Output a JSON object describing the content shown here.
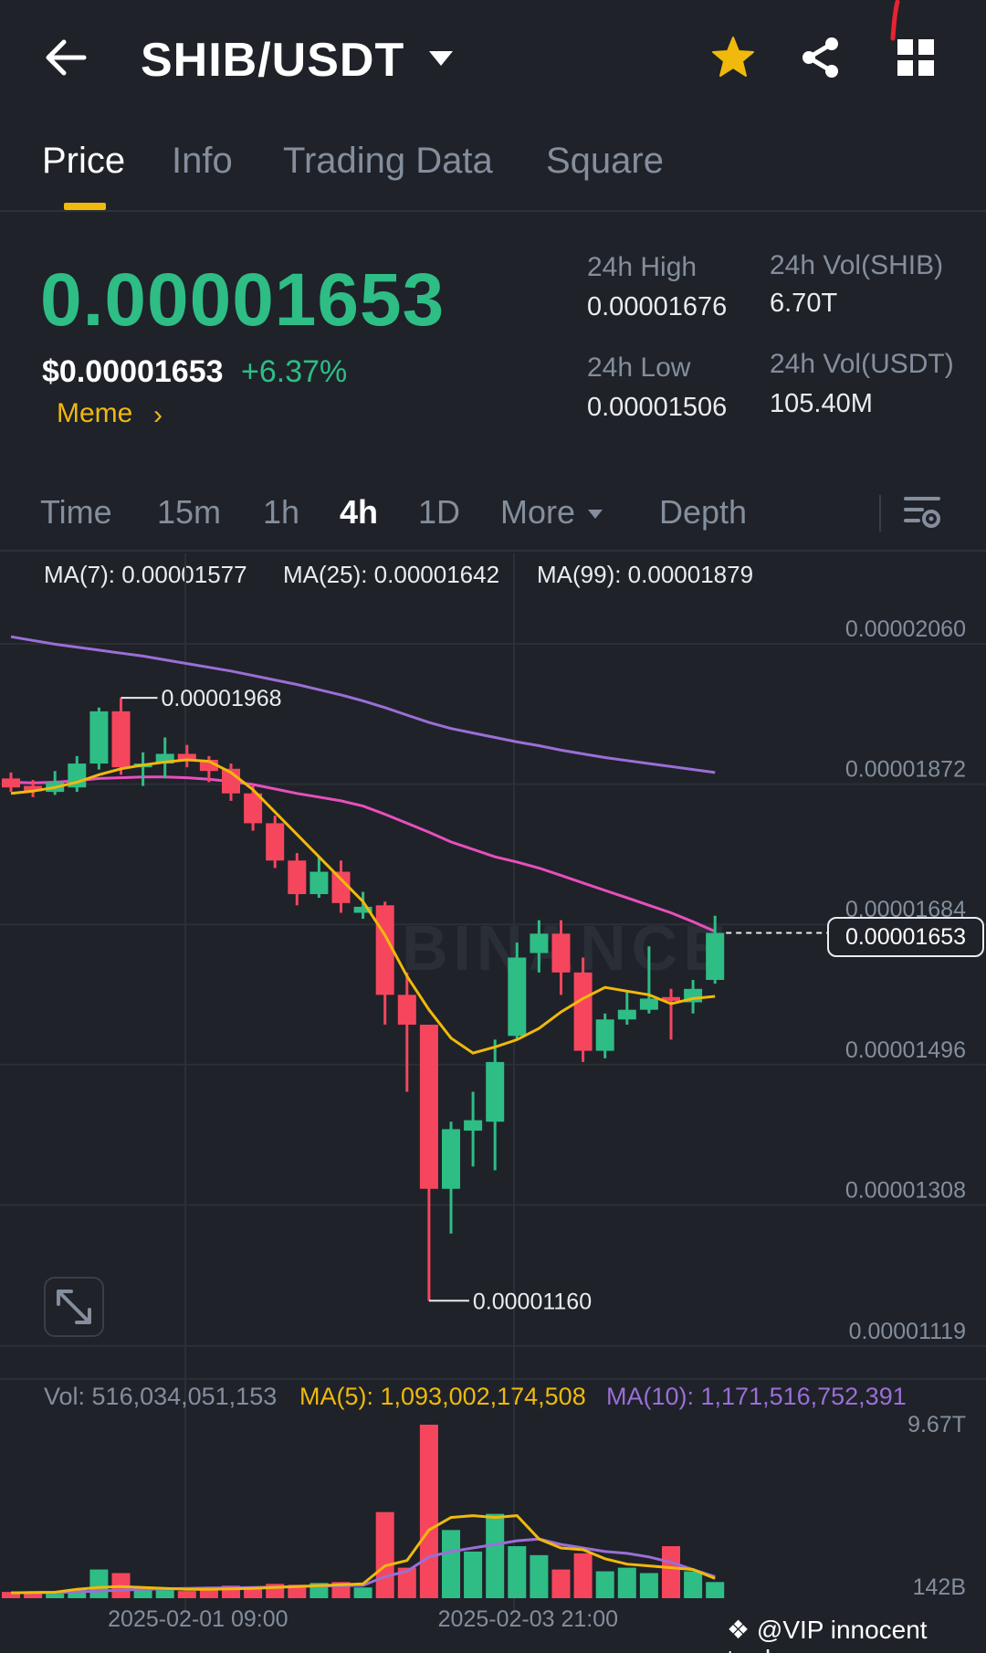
{
  "header": {
    "pair": "SHIB/USDT",
    "back_icon": "arrow-left-icon",
    "star_color": "#f0b90b"
  },
  "tabs": [
    {
      "label": "Price",
      "active": true
    },
    {
      "label": "Info",
      "active": false
    },
    {
      "label": "Trading Data",
      "active": false
    },
    {
      "label": "Square",
      "active": false
    }
  ],
  "price": {
    "last": "0.00001653",
    "usd": "$0.00001653",
    "change": "+6.37%",
    "tag": "Meme"
  },
  "stats": {
    "high_label": "24h High",
    "high_value": "0.00001676",
    "low_label": "24h Low",
    "low_value": "0.00001506",
    "vol_base_label": "24h Vol(SHIB)",
    "vol_base_value": "6.70T",
    "vol_quote_label": "24h Vol(USDT)",
    "vol_quote_value": "105.40M"
  },
  "intervals": {
    "items": [
      "Time",
      "15m",
      "1h",
      "4h",
      "1D",
      "More"
    ],
    "active": "4h",
    "depth": "Depth"
  },
  "ma": {
    "ma7": "MA(7): 0.00001577",
    "ma25": "MA(25): 0.00001642",
    "ma99": "MA(99): 0.00001879",
    "ma7_color": "#f0b90b",
    "ma25_color": "#e84fbd",
    "ma99_color": "#9a6fd6"
  },
  "volume": {
    "vol": "Vol: 516,034,051,153",
    "ma5": "MA(5): 1,093,002,174,508",
    "ma10": "MA(10): 1,171,516,752,391",
    "axis_top": "9.67T",
    "axis_bottom": "142B"
  },
  "chart_data": {
    "type": "candlestick",
    "price_ticks": [
      "0.00002060",
      "0.00001872",
      "0.00001684",
      "0.00001496",
      "0.00001308",
      "0.00001119"
    ],
    "price_tick_values": [
      2.06e-05,
      1.872e-05,
      1.684e-05,
      1.496e-05,
      1.308e-05,
      1.119e-05
    ],
    "ylim": [
      1.06e-05,
      2.12e-05
    ],
    "current_price": "0.00001653",
    "current_price_value": 1.653e-05,
    "high_callout": "0.00001968",
    "high_callout_value": 1.968e-05,
    "low_callout": "0.00001160",
    "low_callout_value": 1.16e-05,
    "high_index": 5,
    "low_index": 19,
    "dates": [
      "2025-02-01 09:00",
      "2025-02-03 21:00"
    ],
    "date_indices": [
      8.5,
      23.5
    ],
    "up_color": "#2ebd85",
    "down_color": "#f6465d",
    "candles": [
      {
        "o": 1.86e-05,
        "h": 1.868e-05,
        "l": 1.842e-05,
        "c": 1.848e-05
      },
      {
        "o": 1.85e-05,
        "h": 1.858e-05,
        "l": 1.835e-05,
        "c": 1.843e-05
      },
      {
        "o": 1.842e-05,
        "h": 1.87e-05,
        "l": 1.838e-05,
        "c": 1.855e-05
      },
      {
        "o": 1.848e-05,
        "h": 1.89e-05,
        "l": 1.842e-05,
        "c": 1.88e-05
      },
      {
        "o": 1.88e-05,
        "h": 1.955e-05,
        "l": 1.872e-05,
        "c": 1.95e-05
      },
      {
        "o": 1.95e-05,
        "h": 1.968e-05,
        "l": 1.865e-05,
        "c": 1.875e-05
      },
      {
        "o": 1.875e-05,
        "h": 1.895e-05,
        "l": 1.85e-05,
        "c": 1.88e-05
      },
      {
        "o": 1.88e-05,
        "h": 1.915e-05,
        "l": 1.86e-05,
        "c": 1.893e-05
      },
      {
        "o": 1.893e-05,
        "h": 1.905e-05,
        "l": 1.875e-05,
        "c": 1.885e-05
      },
      {
        "o": 1.885e-05,
        "h": 1.89e-05,
        "l": 1.855e-05,
        "c": 1.87e-05
      },
      {
        "o": 1.873e-05,
        "h": 1.88e-05,
        "l": 1.83e-05,
        "c": 1.84e-05
      },
      {
        "o": 1.84e-05,
        "h": 1.85e-05,
        "l": 1.79e-05,
        "c": 1.8e-05
      },
      {
        "o": 1.8e-05,
        "h": 1.81e-05,
        "l": 1.74e-05,
        "c": 1.75e-05
      },
      {
        "o": 1.75e-05,
        "h": 1.76e-05,
        "l": 1.69e-05,
        "c": 1.705e-05
      },
      {
        "o": 1.705e-05,
        "h": 1.755e-05,
        "l": 1.7e-05,
        "c": 1.735e-05
      },
      {
        "o": 1.735e-05,
        "h": 1.75e-05,
        "l": 1.68e-05,
        "c": 1.693e-05
      },
      {
        "o": 1.68e-05,
        "h": 1.708e-05,
        "l": 1.672e-05,
        "c": 1.688e-05
      },
      {
        "o": 1.69e-05,
        "h": 1.695e-05,
        "l": 1.53e-05,
        "c": 1.57e-05
      },
      {
        "o": 1.57e-05,
        "h": 1.6e-05,
        "l": 1.44e-05,
        "c": 1.53e-05
      },
      {
        "o": 1.53e-05,
        "h": 1.53e-05,
        "l": 1.16e-05,
        "c": 1.31e-05
      },
      {
        "o": 1.31e-05,
        "h": 1.4e-05,
        "l": 1.25e-05,
        "c": 1.39e-05
      },
      {
        "o": 1.388e-05,
        "h": 1.44e-05,
        "l": 1.34e-05,
        "c": 1.402e-05
      },
      {
        "o": 1.4e-05,
        "h": 1.51e-05,
        "l": 1.335e-05,
        "c": 1.48e-05
      },
      {
        "o": 1.515e-05,
        "h": 1.64e-05,
        "l": 1.51e-05,
        "c": 1.62e-05
      },
      {
        "o": 1.626e-05,
        "h": 1.67e-05,
        "l": 1.6e-05,
        "c": 1.652e-05
      },
      {
        "o": 1.652e-05,
        "h": 1.67e-05,
        "l": 1.57e-05,
        "c": 1.6e-05
      },
      {
        "o": 1.6e-05,
        "h": 1.62e-05,
        "l": 1.48e-05,
        "c": 1.495e-05
      },
      {
        "o": 1.495e-05,
        "h": 1.545e-05,
        "l": 1.485e-05,
        "c": 1.537e-05
      },
      {
        "o": 1.537e-05,
        "h": 1.575e-05,
        "l": 1.53e-05,
        "c": 1.55e-05
      },
      {
        "o": 1.55e-05,
        "h": 1.635e-05,
        "l": 1.545e-05,
        "c": 1.565e-05
      },
      {
        "o": 1.567e-05,
        "h": 1.578e-05,
        "l": 1.51e-05,
        "c": 1.562e-05
      },
      {
        "o": 1.56e-05,
        "h": 1.59e-05,
        "l": 1.545e-05,
        "c": 1.578e-05
      },
      {
        "o": 1.59e-05,
        "h": 1.676e-05,
        "l": 1.585e-05,
        "c": 1.653e-05
      }
    ],
    "ma7_series": [
      1.84e-05,
      1.843e-05,
      1.848e-05,
      1.855e-05,
      1.865e-05,
      1.873e-05,
      1.878e-05,
      1.882e-05,
      1.885e-05,
      1.883e-05,
      1.868e-05,
      1.845e-05,
      1.815e-05,
      1.785e-05,
      1.755e-05,
      1.725e-05,
      1.695e-05,
      1.65e-05,
      1.595e-05,
      1.55e-05,
      1.512e-05,
      1.492e-05,
      1.5e-05,
      1.51e-05,
      1.525e-05,
      1.547e-05,
      1.565e-05,
      1.58e-05,
      1.575e-05,
      1.57e-05,
      1.558e-05,
      1.565e-05,
      1.568e-05
    ],
    "ma25_series": [
      1.855e-05,
      1.854e-05,
      1.855e-05,
      1.857e-05,
      1.86e-05,
      1.861e-05,
      1.862e-05,
      1.862e-05,
      1.861e-05,
      1.859e-05,
      1.856e-05,
      1.852e-05,
      1.846e-05,
      1.84e-05,
      1.835e-05,
      1.83e-05,
      1.823e-05,
      1.812e-05,
      1.8e-05,
      1.788e-05,
      1.775e-05,
      1.765e-05,
      1.755e-05,
      1.748e-05,
      1.74e-05,
      1.73e-05,
      1.72e-05,
      1.71e-05,
      1.7e-05,
      1.69e-05,
      1.68e-05,
      1.668e-05,
      1.655e-05
    ],
    "ma99_series": [
      2.05e-05,
      2.045e-05,
      2.04e-05,
      2.036e-05,
      2.032e-05,
      2.028e-05,
      2.024e-05,
      2.019e-05,
      2.014e-05,
      2.009e-05,
      2.004e-05,
      1.998e-05,
      1.992e-05,
      1.986e-05,
      1.979e-05,
      1.972e-05,
      1.964e-05,
      1.955e-05,
      1.945e-05,
      1.935e-05,
      1.927e-05,
      1.921e-05,
      1.915e-05,
      1.909e-05,
      1.904e-05,
      1.898e-05,
      1.893e-05,
      1.888e-05,
      1.884e-05,
      1.88e-05,
      1.876e-05,
      1.872e-05,
      1.868e-05
    ],
    "volumes": [
      0.35,
      0.3,
      0.25,
      0.45,
      1.6,
      1.4,
      0.5,
      0.45,
      0.4,
      0.5,
      0.7,
      0.6,
      0.8,
      0.75,
      0.85,
      0.9,
      0.6,
      4.8,
      1.7,
      9.67,
      3.8,
      2.6,
      4.7,
      2.9,
      2.4,
      1.6,
      2.5,
      1.5,
      1.7,
      1.4,
      2.9,
      1.5,
      0.9
    ],
    "vol_ma5": [
      0.3,
      0.32,
      0.33,
      0.5,
      0.6,
      0.65,
      0.6,
      0.55,
      0.5,
      0.5,
      0.52,
      0.55,
      0.6,
      0.65,
      0.7,
      0.75,
      0.8,
      1.8,
      2.1,
      3.8,
      4.5,
      4.6,
      4.5,
      4.6,
      3.3,
      2.8,
      2.7,
      2.2,
      1.9,
      1.8,
      1.7,
      1.6,
      1.1
    ],
    "vol_ma10": [
      0.3,
      0.31,
      0.32,
      0.35,
      0.4,
      0.45,
      0.5,
      0.52,
      0.55,
      0.57,
      0.58,
      0.6,
      0.62,
      0.65,
      0.68,
      0.7,
      0.72,
      1.2,
      1.5,
      2.3,
      2.6,
      2.8,
      3.0,
      3.2,
      3.3,
      3.0,
      2.8,
      2.6,
      2.5,
      2.3,
      2.0,
      1.6,
      1.2
    ],
    "vol_max": 9.67
  },
  "credit": "@VIP innocent trader"
}
